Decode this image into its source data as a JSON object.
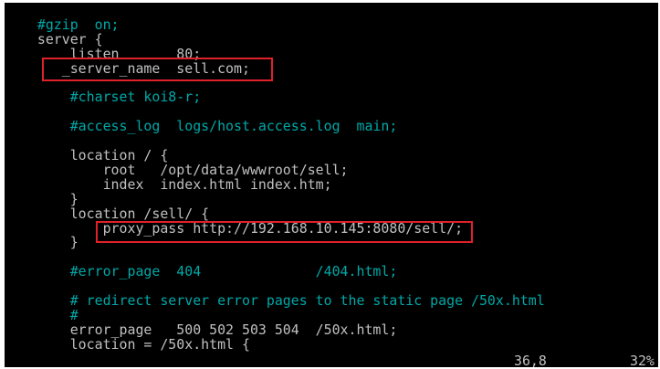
{
  "editor": {
    "lines": [
      {
        "text": "",
        "type": "code"
      },
      {
        "text": "    #gzip  on;",
        "type": "comment"
      },
      {
        "text": "    server {",
        "type": "code"
      },
      {
        "text": "        listen       80;",
        "type": "code"
      },
      {
        "text": "       _server_name  sell.com;",
        "type": "code"
      },
      {
        "text": "",
        "type": "code"
      },
      {
        "text": "        #charset koi8-r;",
        "type": "comment"
      },
      {
        "text": "",
        "type": "code"
      },
      {
        "text": "        #access_log  logs/host.access.log  main;",
        "type": "comment"
      },
      {
        "text": "",
        "type": "code"
      },
      {
        "text": "        location / {",
        "type": "code"
      },
      {
        "text": "            root   /opt/data/wwwroot/sell;",
        "type": "code"
      },
      {
        "text": "            index  index.html index.htm;",
        "type": "code"
      },
      {
        "text": "        }",
        "type": "code"
      },
      {
        "text": "        location /sell/ {",
        "type": "code"
      },
      {
        "text": "            proxy_pass http://192.168.10.145:8080/sell/;",
        "type": "code"
      },
      {
        "text": "        }",
        "type": "code"
      },
      {
        "text": "",
        "type": "code"
      },
      {
        "text": "        #error_page  404              /404.html;",
        "type": "comment"
      },
      {
        "text": "",
        "type": "code"
      },
      {
        "text": "        # redirect server error pages to the static page /50x.html",
        "type": "comment"
      },
      {
        "text": "        #",
        "type": "comment"
      },
      {
        "text": "        error_page   500 502 503 504  /50x.html;",
        "type": "code"
      },
      {
        "text": "        location = /50x.html {",
        "type": "code"
      }
    ],
    "status": {
      "position": "36,8",
      "percent": "32%"
    },
    "colors": {
      "background": "#000000",
      "text": "#c0c0c0",
      "comment": "#00a8a8",
      "highlight_box": "#e0202a"
    }
  }
}
